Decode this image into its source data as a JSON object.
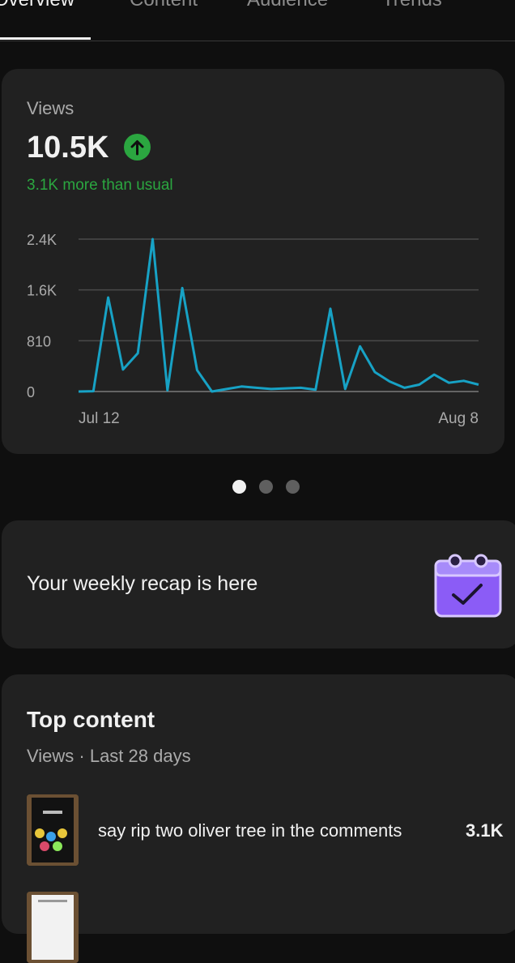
{
  "tabs": [
    {
      "label": "Overview",
      "active": true
    },
    {
      "label": "Content",
      "active": false
    },
    {
      "label": "Audience",
      "active": false
    },
    {
      "label": "Trends",
      "active": false
    }
  ],
  "views_card": {
    "title": "Views",
    "value": "10.5K",
    "trend_icon": "arrow-up-icon",
    "subtitle": "3.1K more than usual",
    "accent_color": "#2ba640"
  },
  "chart_data": {
    "type": "line",
    "title": "",
    "xlabel": "",
    "ylabel": "",
    "y_ticks": [
      "2.4K",
      "1.6K",
      "810",
      "0"
    ],
    "y_tick_values": [
      2430,
      1620,
      810,
      0
    ],
    "ylim": [
      0,
      2430
    ],
    "x_labels": [
      "Jul 12",
      "Aug 8"
    ],
    "grid": true,
    "line_color": "#17a2c5",
    "series": [
      {
        "values": [
          0,
          5,
          1500,
          350,
          610,
          2430,
          20,
          1650,
          340,
          0,
          40,
          80,
          60,
          40,
          50,
          60,
          30,
          1320,
          40,
          720,
          310,
          160,
          60,
          110,
          270,
          140,
          170,
          110
        ]
      }
    ]
  },
  "pager": {
    "count": 3,
    "active_index": 0
  },
  "recap": {
    "text": "Your weekly recap is here",
    "icon": "calendar-check-icon"
  },
  "top_content": {
    "title": "Top content",
    "subtitle": "Views · Last 28 days",
    "items": [
      {
        "title": "say rip two oliver tree in the comments",
        "views": "3.1K"
      }
    ]
  }
}
